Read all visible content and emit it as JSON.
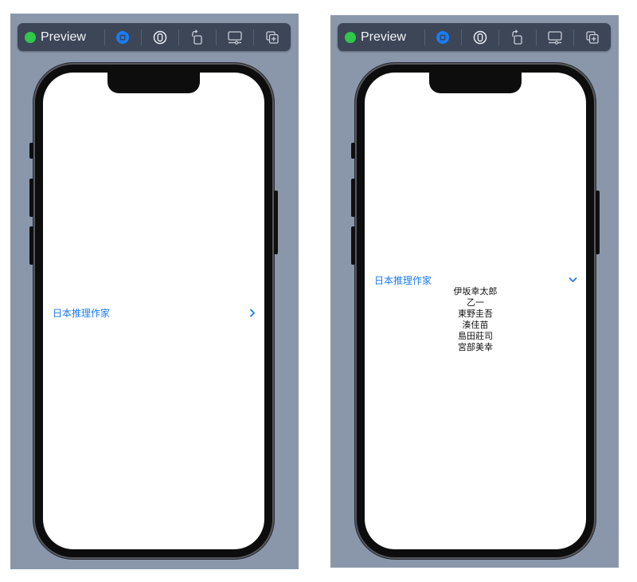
{
  "left": {
    "toolbar": {
      "preview_label": "Preview"
    },
    "disclosure": {
      "title": "日本推理作家",
      "expanded": false
    }
  },
  "right": {
    "toolbar": {
      "preview_label": "Preview"
    },
    "disclosure": {
      "title": "日本推理作家",
      "expanded": true,
      "items": [
        "伊坂幸太郎",
        "乙一",
        "東野圭吾",
        "湊佳苗",
        "島田莊司",
        "宮部美幸"
      ]
    }
  },
  "colors": {
    "accent": "#1a7cf5",
    "live": "#2fc84a",
    "panel_bg": "#8a97ab",
    "toolbar_bg": "#3c4656"
  },
  "icons": [
    "live-indicator",
    "live-mode-icon",
    "selectable-mode-icon",
    "rotate-icon",
    "device-settings-icon",
    "duplicate-icon",
    "chevron-right-icon",
    "chevron-down-icon"
  ]
}
